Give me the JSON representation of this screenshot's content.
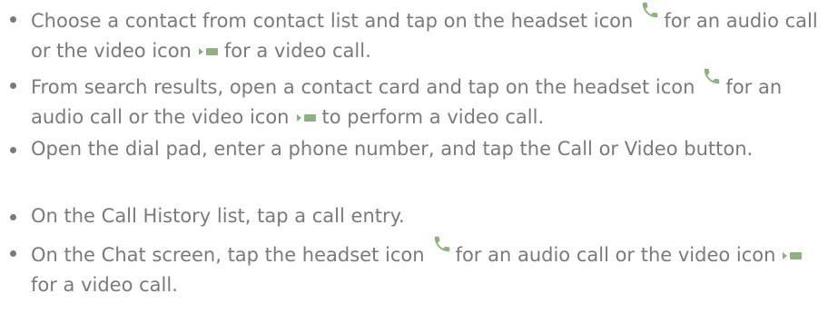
{
  "steps": [
    {
      "before": "Choose a contact from contact list and tap on the headset icon",
      "middle": "for an audio call or the video icon",
      "after": "for a video call."
    },
    {
      "before": "From search results, open a contact card and tap on the headset icon",
      "middle": "for an audio call or the video icon",
      "after": "to perform a video call."
    },
    {
      "text": "Open the dial pad, enter a phone number, and tap the Call or Video button."
    },
    {
      "text": "On the Call History  list, tap a call entry."
    },
    {
      "before": "On the Chat  screen, tap the headset icon",
      "middle": "for an audio call or the video icon",
      "after": "for a video call."
    }
  ],
  "icons": {
    "audio": "phone-icon",
    "video": "video-icon",
    "color": "#8fb082"
  }
}
